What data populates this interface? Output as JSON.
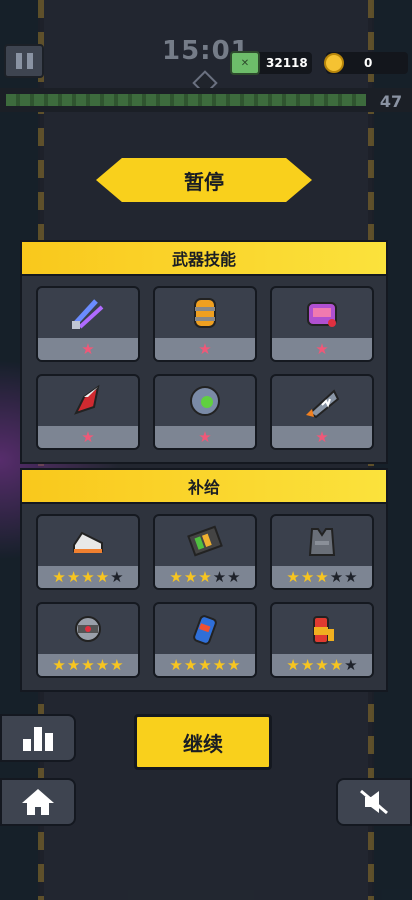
{
  "hud": {
    "timer": "15:01",
    "kills": "32118",
    "coins": "0",
    "level": "47",
    "xp_progress": 0.9
  },
  "pause_title": "暂停",
  "weapon_section": {
    "title": "武器技能",
    "items": [
      {
        "name": "plasma-blades",
        "icon": "blade-icon",
        "stars": 1
      },
      {
        "name": "grenade",
        "icon": "canister-icon",
        "stars": 1
      },
      {
        "name": "gamepad-drone",
        "icon": "gamepad-icon",
        "stars": 1
      },
      {
        "name": "shuriken",
        "icon": "shuriken-icon",
        "stars": 1
      },
      {
        "name": "energy-orb",
        "icon": "orb-icon",
        "stars": 1
      },
      {
        "name": "shark-rocket",
        "icon": "shark-icon",
        "stars": 1
      }
    ]
  },
  "supply_section": {
    "title": "补给",
    "items": [
      {
        "name": "sneakers",
        "icon": "shoe-icon",
        "stars": 4
      },
      {
        "name": "battery",
        "icon": "battery-icon",
        "stars": 3
      },
      {
        "name": "armor-vest",
        "icon": "vest-icon",
        "stars": 3
      },
      {
        "name": "magnet-core",
        "icon": "core-icon",
        "stars": 5
      },
      {
        "name": "drink-can",
        "icon": "can-icon",
        "stars": 5
      },
      {
        "name": "fuel-cell",
        "icon": "fuel-icon",
        "stars": 4
      }
    ]
  },
  "continue_label": "继续",
  "colors": {
    "accent": "#f9d01c",
    "panel": "#2e333d",
    "star_gold": "#f7c520",
    "star_pink": "#f05878"
  }
}
